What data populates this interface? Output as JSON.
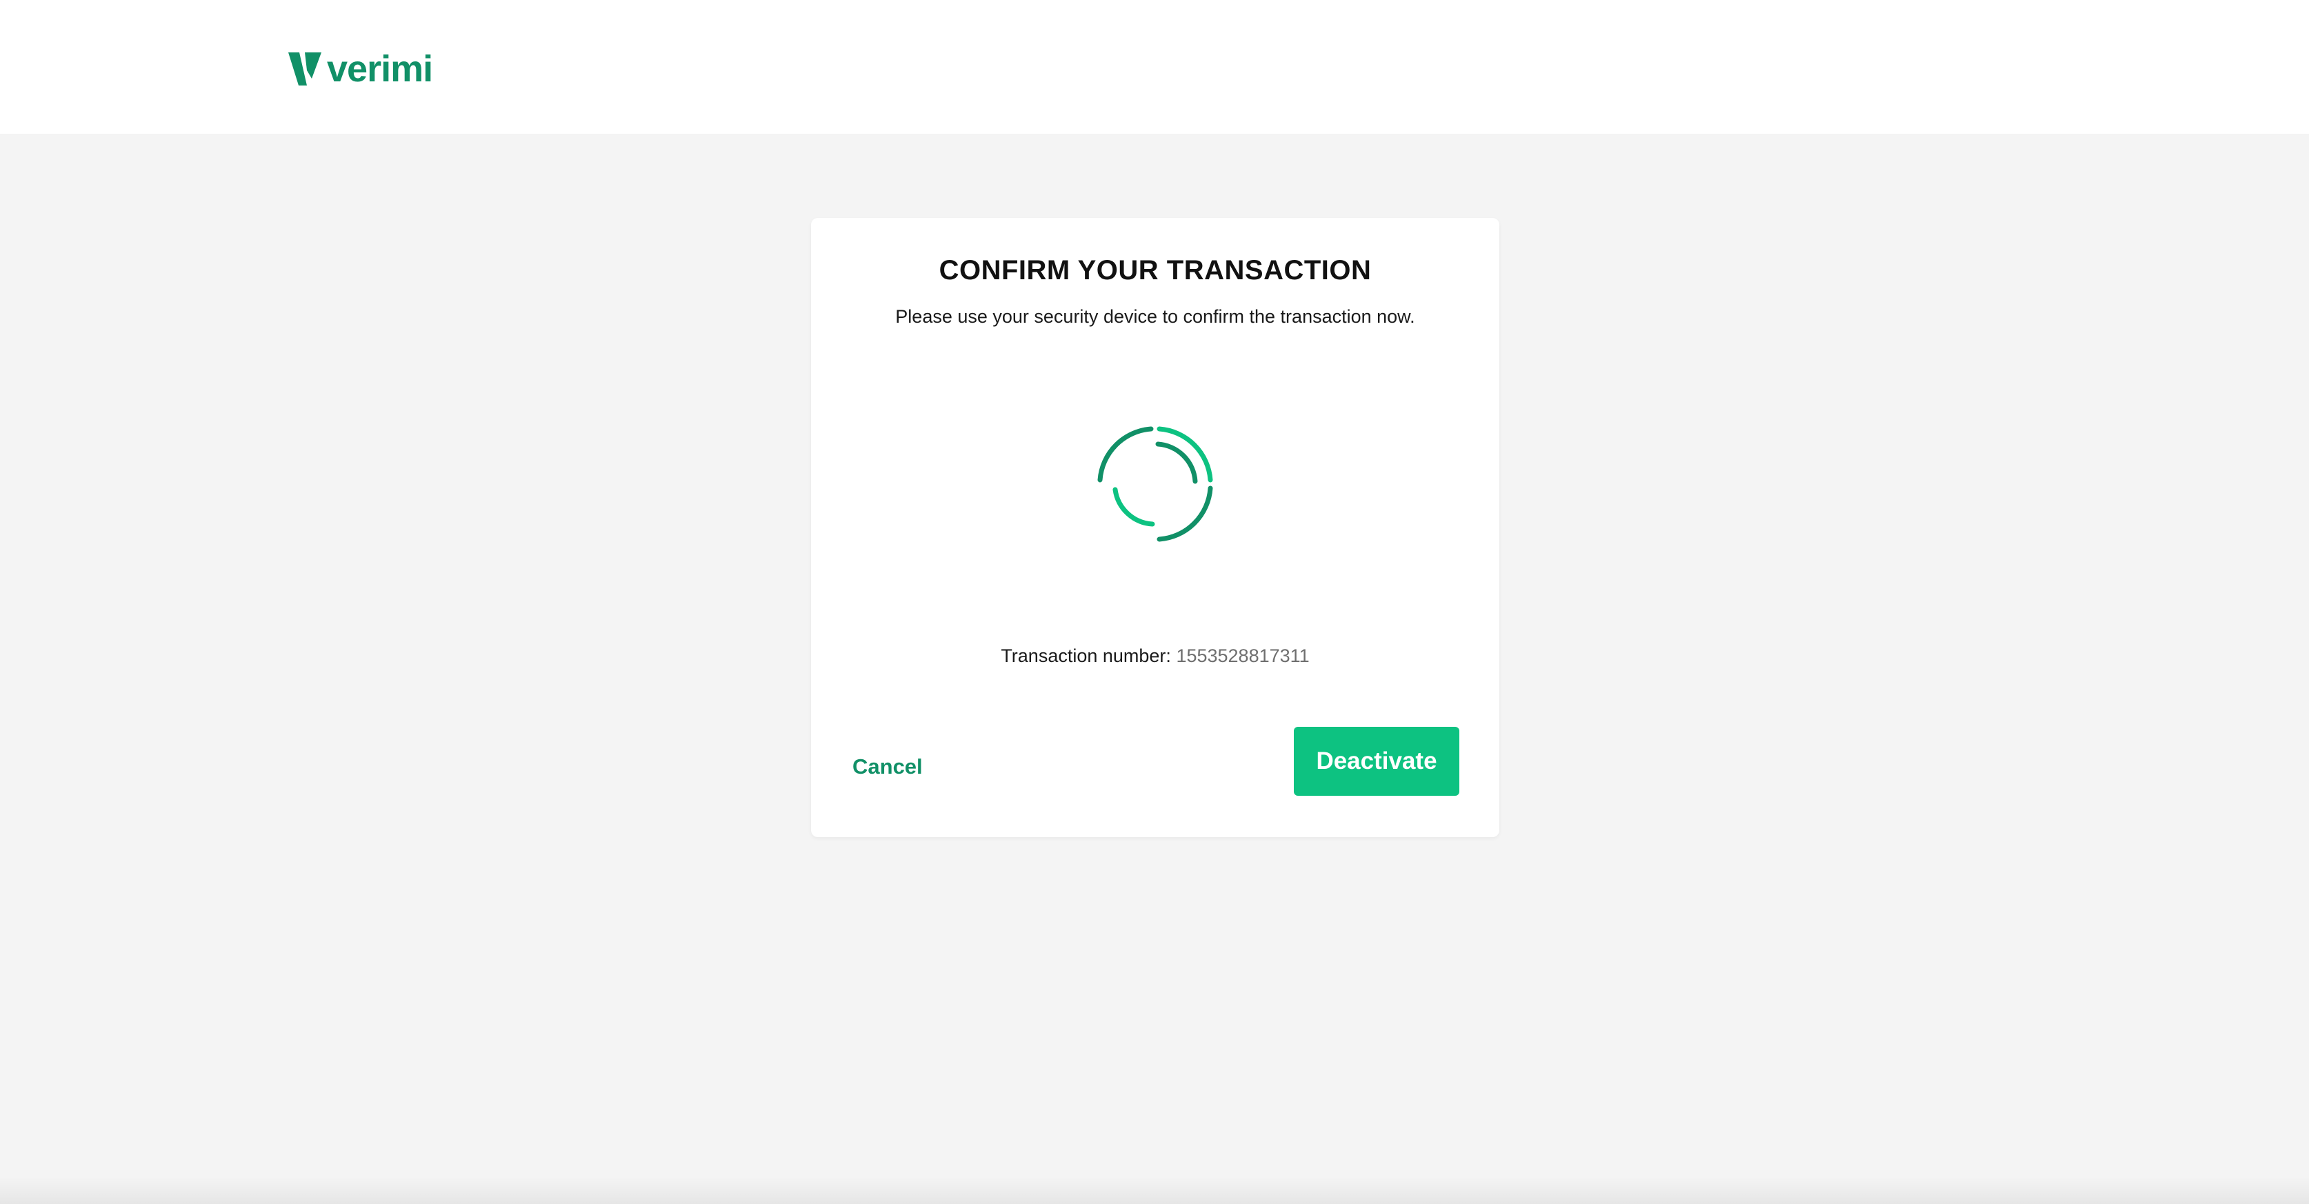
{
  "header": {
    "logo_text": "verimi",
    "logo_icon": "verimi-v-icon"
  },
  "dialog": {
    "title": "CONFIRM YOUR TRANSACTION",
    "subtitle": "Please use your security device to confirm the transaction now.",
    "spinner_icon": "loading-spinner-icon",
    "transaction_label": "Transaction number:",
    "transaction_number": "1553528817311",
    "cancel_label": "Cancel",
    "deactivate_label": "Deactivate"
  },
  "colors": {
    "brand_green": "#119067",
    "button_green": "#0dc281",
    "background": "#f4f4f4"
  }
}
